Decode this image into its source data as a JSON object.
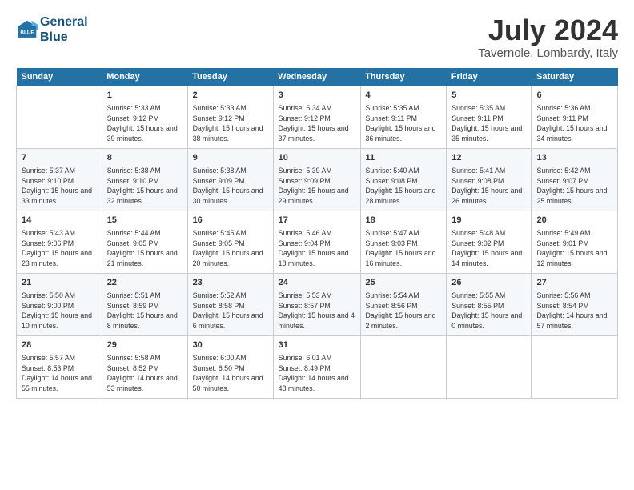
{
  "logo": {
    "line1": "General",
    "line2": "Blue"
  },
  "title": "July 2024",
  "location": "Tavernole, Lombardy, Italy",
  "headers": [
    "Sunday",
    "Monday",
    "Tuesday",
    "Wednesday",
    "Thursday",
    "Friday",
    "Saturday"
  ],
  "weeks": [
    [
      {
        "day": "",
        "sunrise": "",
        "sunset": "",
        "daylight": ""
      },
      {
        "day": "1",
        "sunrise": "Sunrise: 5:33 AM",
        "sunset": "Sunset: 9:12 PM",
        "daylight": "Daylight: 15 hours and 39 minutes."
      },
      {
        "day": "2",
        "sunrise": "Sunrise: 5:33 AM",
        "sunset": "Sunset: 9:12 PM",
        "daylight": "Daylight: 15 hours and 38 minutes."
      },
      {
        "day": "3",
        "sunrise": "Sunrise: 5:34 AM",
        "sunset": "Sunset: 9:12 PM",
        "daylight": "Daylight: 15 hours and 37 minutes."
      },
      {
        "day": "4",
        "sunrise": "Sunrise: 5:35 AM",
        "sunset": "Sunset: 9:11 PM",
        "daylight": "Daylight: 15 hours and 36 minutes."
      },
      {
        "day": "5",
        "sunrise": "Sunrise: 5:35 AM",
        "sunset": "Sunset: 9:11 PM",
        "daylight": "Daylight: 15 hours and 35 minutes."
      },
      {
        "day": "6",
        "sunrise": "Sunrise: 5:36 AM",
        "sunset": "Sunset: 9:11 PM",
        "daylight": "Daylight: 15 hours and 34 minutes."
      }
    ],
    [
      {
        "day": "7",
        "sunrise": "Sunrise: 5:37 AM",
        "sunset": "Sunset: 9:10 PM",
        "daylight": "Daylight: 15 hours and 33 minutes."
      },
      {
        "day": "8",
        "sunrise": "Sunrise: 5:38 AM",
        "sunset": "Sunset: 9:10 PM",
        "daylight": "Daylight: 15 hours and 32 minutes."
      },
      {
        "day": "9",
        "sunrise": "Sunrise: 5:38 AM",
        "sunset": "Sunset: 9:09 PM",
        "daylight": "Daylight: 15 hours and 30 minutes."
      },
      {
        "day": "10",
        "sunrise": "Sunrise: 5:39 AM",
        "sunset": "Sunset: 9:09 PM",
        "daylight": "Daylight: 15 hours and 29 minutes."
      },
      {
        "day": "11",
        "sunrise": "Sunrise: 5:40 AM",
        "sunset": "Sunset: 9:08 PM",
        "daylight": "Daylight: 15 hours and 28 minutes."
      },
      {
        "day": "12",
        "sunrise": "Sunrise: 5:41 AM",
        "sunset": "Sunset: 9:08 PM",
        "daylight": "Daylight: 15 hours and 26 minutes."
      },
      {
        "day": "13",
        "sunrise": "Sunrise: 5:42 AM",
        "sunset": "Sunset: 9:07 PM",
        "daylight": "Daylight: 15 hours and 25 minutes."
      }
    ],
    [
      {
        "day": "14",
        "sunrise": "Sunrise: 5:43 AM",
        "sunset": "Sunset: 9:06 PM",
        "daylight": "Daylight: 15 hours and 23 minutes."
      },
      {
        "day": "15",
        "sunrise": "Sunrise: 5:44 AM",
        "sunset": "Sunset: 9:05 PM",
        "daylight": "Daylight: 15 hours and 21 minutes."
      },
      {
        "day": "16",
        "sunrise": "Sunrise: 5:45 AM",
        "sunset": "Sunset: 9:05 PM",
        "daylight": "Daylight: 15 hours and 20 minutes."
      },
      {
        "day": "17",
        "sunrise": "Sunrise: 5:46 AM",
        "sunset": "Sunset: 9:04 PM",
        "daylight": "Daylight: 15 hours and 18 minutes."
      },
      {
        "day": "18",
        "sunrise": "Sunrise: 5:47 AM",
        "sunset": "Sunset: 9:03 PM",
        "daylight": "Daylight: 15 hours and 16 minutes."
      },
      {
        "day": "19",
        "sunrise": "Sunrise: 5:48 AM",
        "sunset": "Sunset: 9:02 PM",
        "daylight": "Daylight: 15 hours and 14 minutes."
      },
      {
        "day": "20",
        "sunrise": "Sunrise: 5:49 AM",
        "sunset": "Sunset: 9:01 PM",
        "daylight": "Daylight: 15 hours and 12 minutes."
      }
    ],
    [
      {
        "day": "21",
        "sunrise": "Sunrise: 5:50 AM",
        "sunset": "Sunset: 9:00 PM",
        "daylight": "Daylight: 15 hours and 10 minutes."
      },
      {
        "day": "22",
        "sunrise": "Sunrise: 5:51 AM",
        "sunset": "Sunset: 8:59 PM",
        "daylight": "Daylight: 15 hours and 8 minutes."
      },
      {
        "day": "23",
        "sunrise": "Sunrise: 5:52 AM",
        "sunset": "Sunset: 8:58 PM",
        "daylight": "Daylight: 15 hours and 6 minutes."
      },
      {
        "day": "24",
        "sunrise": "Sunrise: 5:53 AM",
        "sunset": "Sunset: 8:57 PM",
        "daylight": "Daylight: 15 hours and 4 minutes."
      },
      {
        "day": "25",
        "sunrise": "Sunrise: 5:54 AM",
        "sunset": "Sunset: 8:56 PM",
        "daylight": "Daylight: 15 hours and 2 minutes."
      },
      {
        "day": "26",
        "sunrise": "Sunrise: 5:55 AM",
        "sunset": "Sunset: 8:55 PM",
        "daylight": "Daylight: 15 hours and 0 minutes."
      },
      {
        "day": "27",
        "sunrise": "Sunrise: 5:56 AM",
        "sunset": "Sunset: 8:54 PM",
        "daylight": "Daylight: 14 hours and 57 minutes."
      }
    ],
    [
      {
        "day": "28",
        "sunrise": "Sunrise: 5:57 AM",
        "sunset": "Sunset: 8:53 PM",
        "daylight": "Daylight: 14 hours and 55 minutes."
      },
      {
        "day": "29",
        "sunrise": "Sunrise: 5:58 AM",
        "sunset": "Sunset: 8:52 PM",
        "daylight": "Daylight: 14 hours and 53 minutes."
      },
      {
        "day": "30",
        "sunrise": "Sunrise: 6:00 AM",
        "sunset": "Sunset: 8:50 PM",
        "daylight": "Daylight: 14 hours and 50 minutes."
      },
      {
        "day": "31",
        "sunrise": "Sunrise: 6:01 AM",
        "sunset": "Sunset: 8:49 PM",
        "daylight": "Daylight: 14 hours and 48 minutes."
      },
      {
        "day": "",
        "sunrise": "",
        "sunset": "",
        "daylight": ""
      },
      {
        "day": "",
        "sunrise": "",
        "sunset": "",
        "daylight": ""
      },
      {
        "day": "",
        "sunrise": "",
        "sunset": "",
        "daylight": ""
      }
    ]
  ]
}
